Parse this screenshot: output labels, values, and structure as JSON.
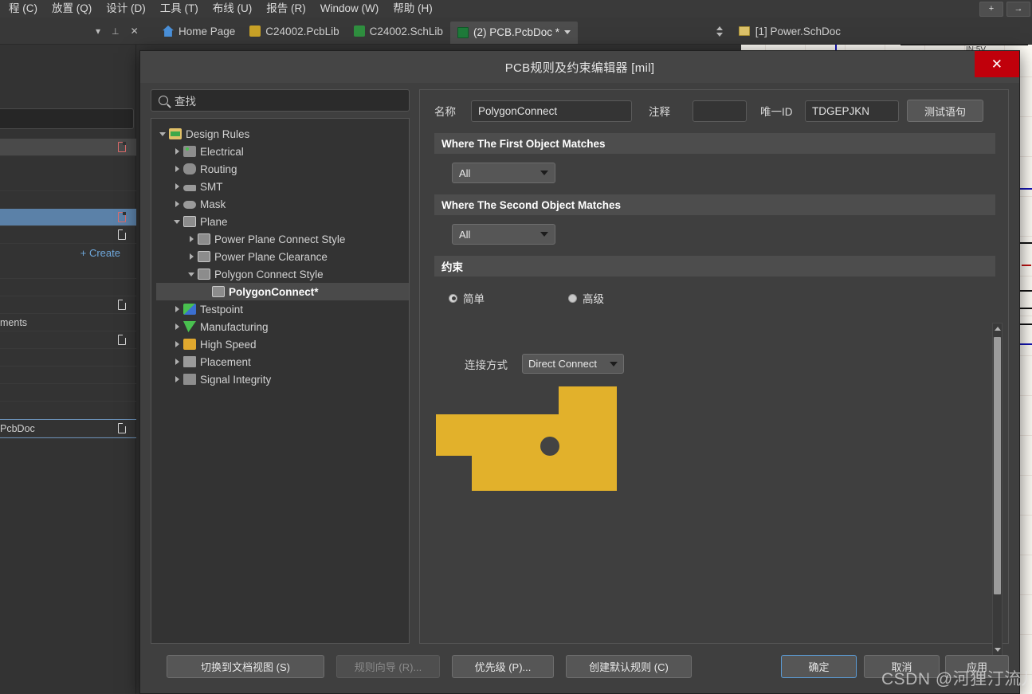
{
  "menubar": {
    "items": [
      "程 (C)",
      "放置 (Q)",
      "设计 (D)",
      "工具 (T)",
      "布线 (U)",
      "报告 (R)",
      "Window (W)",
      "帮助 (H)"
    ],
    "right_buttons": [
      "+",
      "→"
    ]
  },
  "tabbar": {
    "panel_controls": [
      "▾",
      "📌",
      "✕"
    ],
    "tabs": [
      {
        "label": "Home Page",
        "icon": "home-icon",
        "active": false
      },
      {
        "label": "C24002.PcbLib",
        "icon": "pcblib-icon",
        "active": false
      },
      {
        "label": "C24002.SchLib",
        "icon": "schlib-icon",
        "active": false
      },
      {
        "label": "(2) PCB.PcbDoc *",
        "icon": "pcbdoc-icon",
        "active": true
      }
    ],
    "right_document": "[1] Power.SchDoc"
  },
  "left_panel": {
    "create_label": "+ Create",
    "rows": [
      {
        "text": "",
        "state": "hover"
      },
      {
        "text": "",
        "state": "normal"
      },
      {
        "text": "",
        "state": "selected"
      },
      {
        "text": "",
        "state": "normal"
      },
      {
        "text": "ments",
        "state": "normal"
      },
      {
        "text": "PcbDoc",
        "state": "normal"
      }
    ]
  },
  "dialog": {
    "title": "PCB规则及约束编辑器 [mil]",
    "close_label": "✕",
    "search": {
      "placeholder": "查找",
      "value": "查找",
      "icon": "search-icon"
    },
    "tree": {
      "root": "Design Rules",
      "nodes": [
        {
          "label": "Design Rules",
          "depth": 0,
          "expanded": true,
          "icon": "design-rules-folder-icon",
          "selected": false
        },
        {
          "label": "Electrical",
          "depth": 1,
          "expanded": false,
          "icon": "electrical-icon",
          "selected": false
        },
        {
          "label": "Routing",
          "depth": 1,
          "expanded": false,
          "icon": "routing-icon",
          "selected": false
        },
        {
          "label": "SMT",
          "depth": 1,
          "expanded": false,
          "icon": "smt-icon",
          "selected": false
        },
        {
          "label": "Mask",
          "depth": 1,
          "expanded": false,
          "icon": "mask-icon",
          "selected": false
        },
        {
          "label": "Plane",
          "depth": 1,
          "expanded": true,
          "icon": "plane-icon",
          "selected": false
        },
        {
          "label": "Power Plane Connect Style",
          "depth": 2,
          "expanded": false,
          "icon": "plane-icon",
          "selected": false
        },
        {
          "label": "Power Plane Clearance",
          "depth": 2,
          "expanded": false,
          "icon": "plane-icon",
          "selected": false
        },
        {
          "label": "Polygon Connect Style",
          "depth": 2,
          "expanded": true,
          "icon": "plane-icon",
          "selected": false
        },
        {
          "label": "PolygonConnect*",
          "depth": 3,
          "expanded": null,
          "icon": "plane-icon",
          "selected": true
        },
        {
          "label": "Testpoint",
          "depth": 1,
          "expanded": false,
          "icon": "testpoint-icon",
          "selected": false
        },
        {
          "label": "Manufacturing",
          "depth": 1,
          "expanded": false,
          "icon": "manufacturing-icon",
          "selected": false
        },
        {
          "label": "High Speed",
          "depth": 1,
          "expanded": false,
          "icon": "high-speed-icon",
          "selected": false
        },
        {
          "label": "Placement",
          "depth": 1,
          "expanded": false,
          "icon": "placement-icon",
          "selected": false
        },
        {
          "label": "Signal Integrity",
          "depth": 1,
          "expanded": false,
          "icon": "signal-integrity-icon",
          "selected": false
        }
      ]
    },
    "rule": {
      "name_label": "名称",
      "name_value": "PolygonConnect",
      "comment_label": "注释",
      "comment_value": "",
      "uid_label": "唯一ID",
      "uid_value": "TDGEPJKN",
      "test_query_button": "测试语句",
      "first_object_header": "Where The First Object Matches",
      "first_object_scope": "All",
      "second_object_header": "Where The Second Object Matches",
      "second_object_scope": "All",
      "constraints_header": "约束",
      "mode_simple": "简单",
      "mode_advanced": "高级",
      "mode_selected": "简单",
      "connect_style_label": "连接方式",
      "connect_style_value": "Direct Connect"
    },
    "footer": {
      "buttons": [
        {
          "label": "切换到文档视图 (S)",
          "state": "normal"
        },
        {
          "label": "规则向导 (R)...",
          "state": "disabled"
        },
        {
          "label": "优先级 (P)...",
          "state": "normal"
        },
        {
          "label": "创建默认规则 (C)",
          "state": "normal"
        },
        {
          "label": "确定",
          "state": "primary"
        },
        {
          "label": "取消",
          "state": "normal"
        },
        {
          "label": "应用",
          "state": "normal"
        }
      ]
    }
  },
  "watermark": "CSDN @河狸汀流儿",
  "colors": {
    "polygon_fill": "#e2b12b",
    "pad_hole": "#434343",
    "dialog_bg": "#3f3f3f",
    "close_red": "#c0000b",
    "selection_blue": "#5b81a8",
    "primary_outline": "#5b9bd5"
  },
  "preview": {
    "shape": "polygon-direct-connect",
    "description": "Yellow copper polygon with circular pad hole"
  }
}
